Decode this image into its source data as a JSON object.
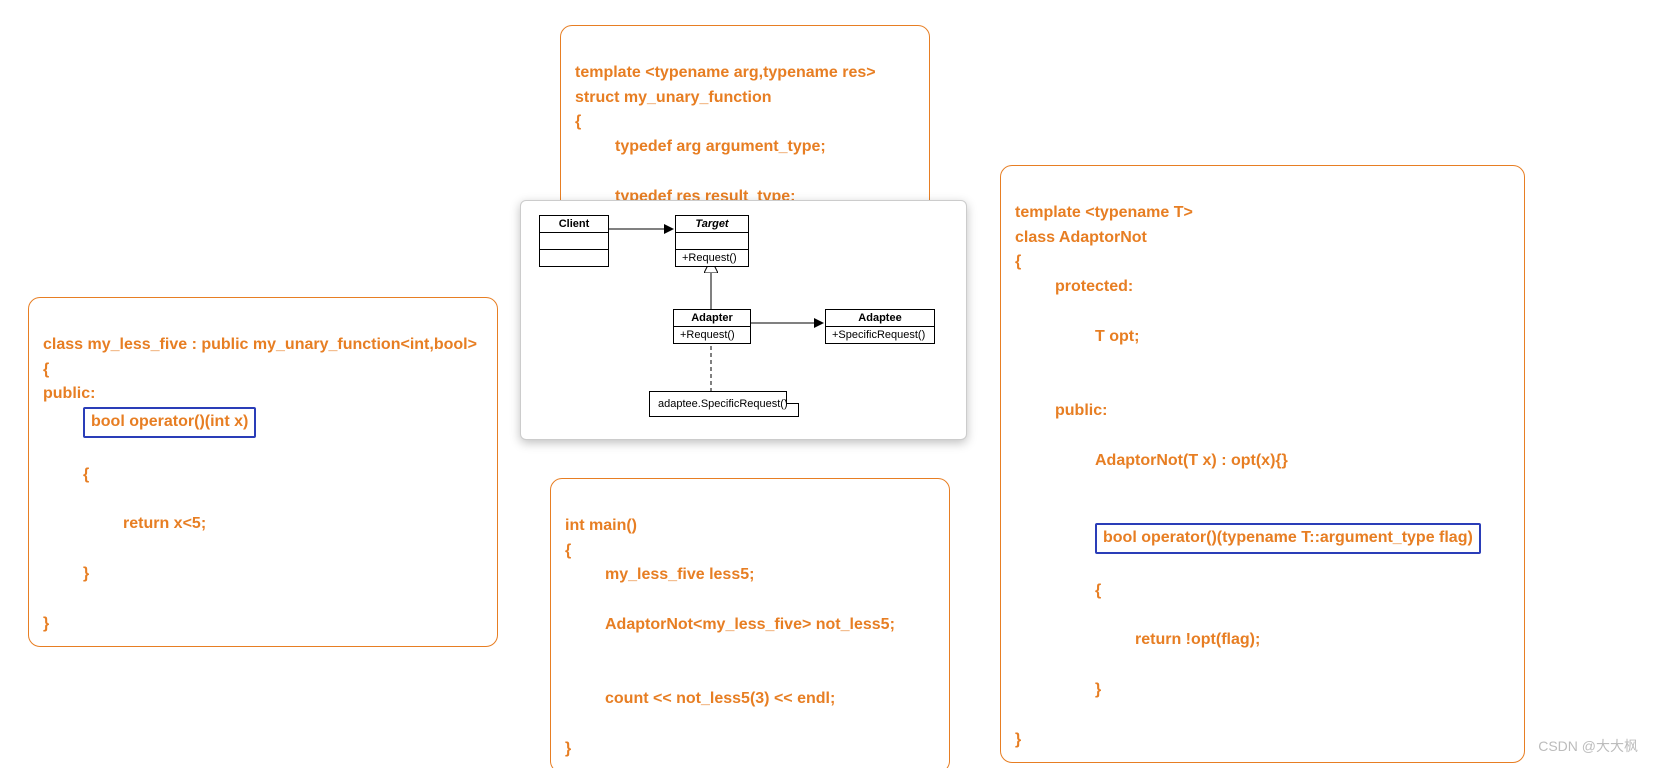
{
  "boxTop": {
    "l1": "template <typename arg,typename res>",
    "l2": "struct my_unary_function",
    "l3": "{",
    "l4": "typedef arg argument_type;",
    "l5": "typedef res result_type;",
    "l6": "}"
  },
  "boxLeft": {
    "l1": "class my_less_five : public my_unary_function<int,bool>",
    "l2": "{",
    "l3": "public:",
    "hl": "bool operator()(int x)",
    "l5": "{",
    "l6": "return x<5;",
    "l7": "}",
    "l8": "}"
  },
  "boxRight": {
    "l1": "template <typename T>",
    "l2": "class AdaptorNot",
    "l3": "{",
    "l4": "protected:",
    "l5": "T opt;",
    "blank1": " ",
    "l6": "public:",
    "l7": "AdaptorNot(T x) : opt(x){}",
    "blank2": " ",
    "hl": "bool operator()(typename T::argument_type flag)",
    "l9": "{",
    "l10": "return !opt(flag);",
    "l11": "}",
    "l12": "}"
  },
  "boxBottom": {
    "l1": "int main()",
    "l2": "{",
    "l3": "my_less_five less5;",
    "l4": "AdaptorNot<my_less_five> not_less5;",
    "blank": " ",
    "l5": "count << not_less5(3) << endl;",
    "l6": "}"
  },
  "uml": {
    "client": "Client",
    "target": "Target",
    "target_m": "+Request()",
    "adapter": "Adapter",
    "adapter_m": "+Request()",
    "adaptee": "Adaptee",
    "adaptee_m": "+SpecificRequest()",
    "note": "adaptee.SpecificRequest()"
  },
  "watermark": "CSDN @大大枫"
}
